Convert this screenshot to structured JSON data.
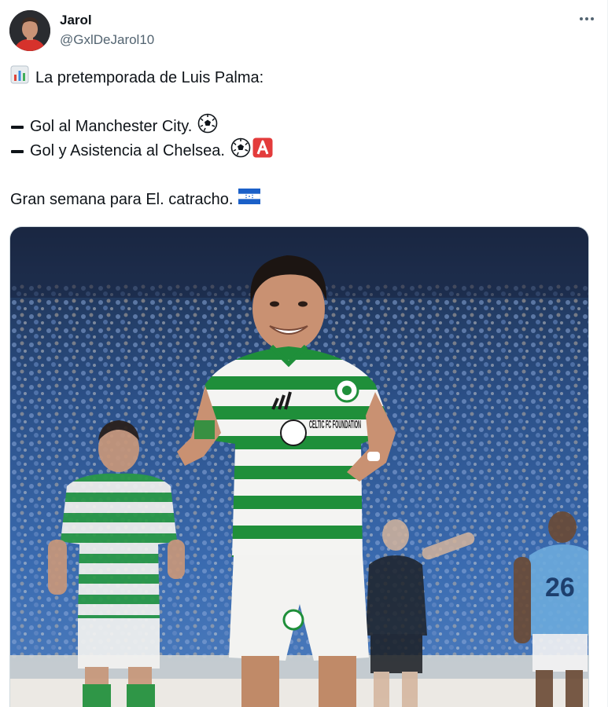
{
  "author": {
    "display_name": "Jarol",
    "handle": "@GxlDeJarol10"
  },
  "tweet": {
    "line1": "La pretemporada de Luis Palma:",
    "line2": "Gol al Manchester City.",
    "line3": "Gol y Asistencia al Chelsea.",
    "line4": "Gran semana para El. catracho."
  },
  "media": {
    "jersey_sponsor": "CELTIC FC FOUNDATION",
    "opponent_number": "26"
  },
  "icons": {
    "chart": "bar-chart-emoji-icon",
    "dash": "heavy-minus-icon",
    "ball": "soccer-ball-icon",
    "assist": "letter-a-button-icon",
    "flag": "honduras-flag-icon",
    "more": "more-options-icon"
  },
  "colors": {
    "text": "#0f1419",
    "secondary": "#536471",
    "celtic_green": "#1f8f3a",
    "sky_blue": "#6cabdd",
    "assist_red": "#e33b3b",
    "honduras_blue": "#1b60c8"
  }
}
